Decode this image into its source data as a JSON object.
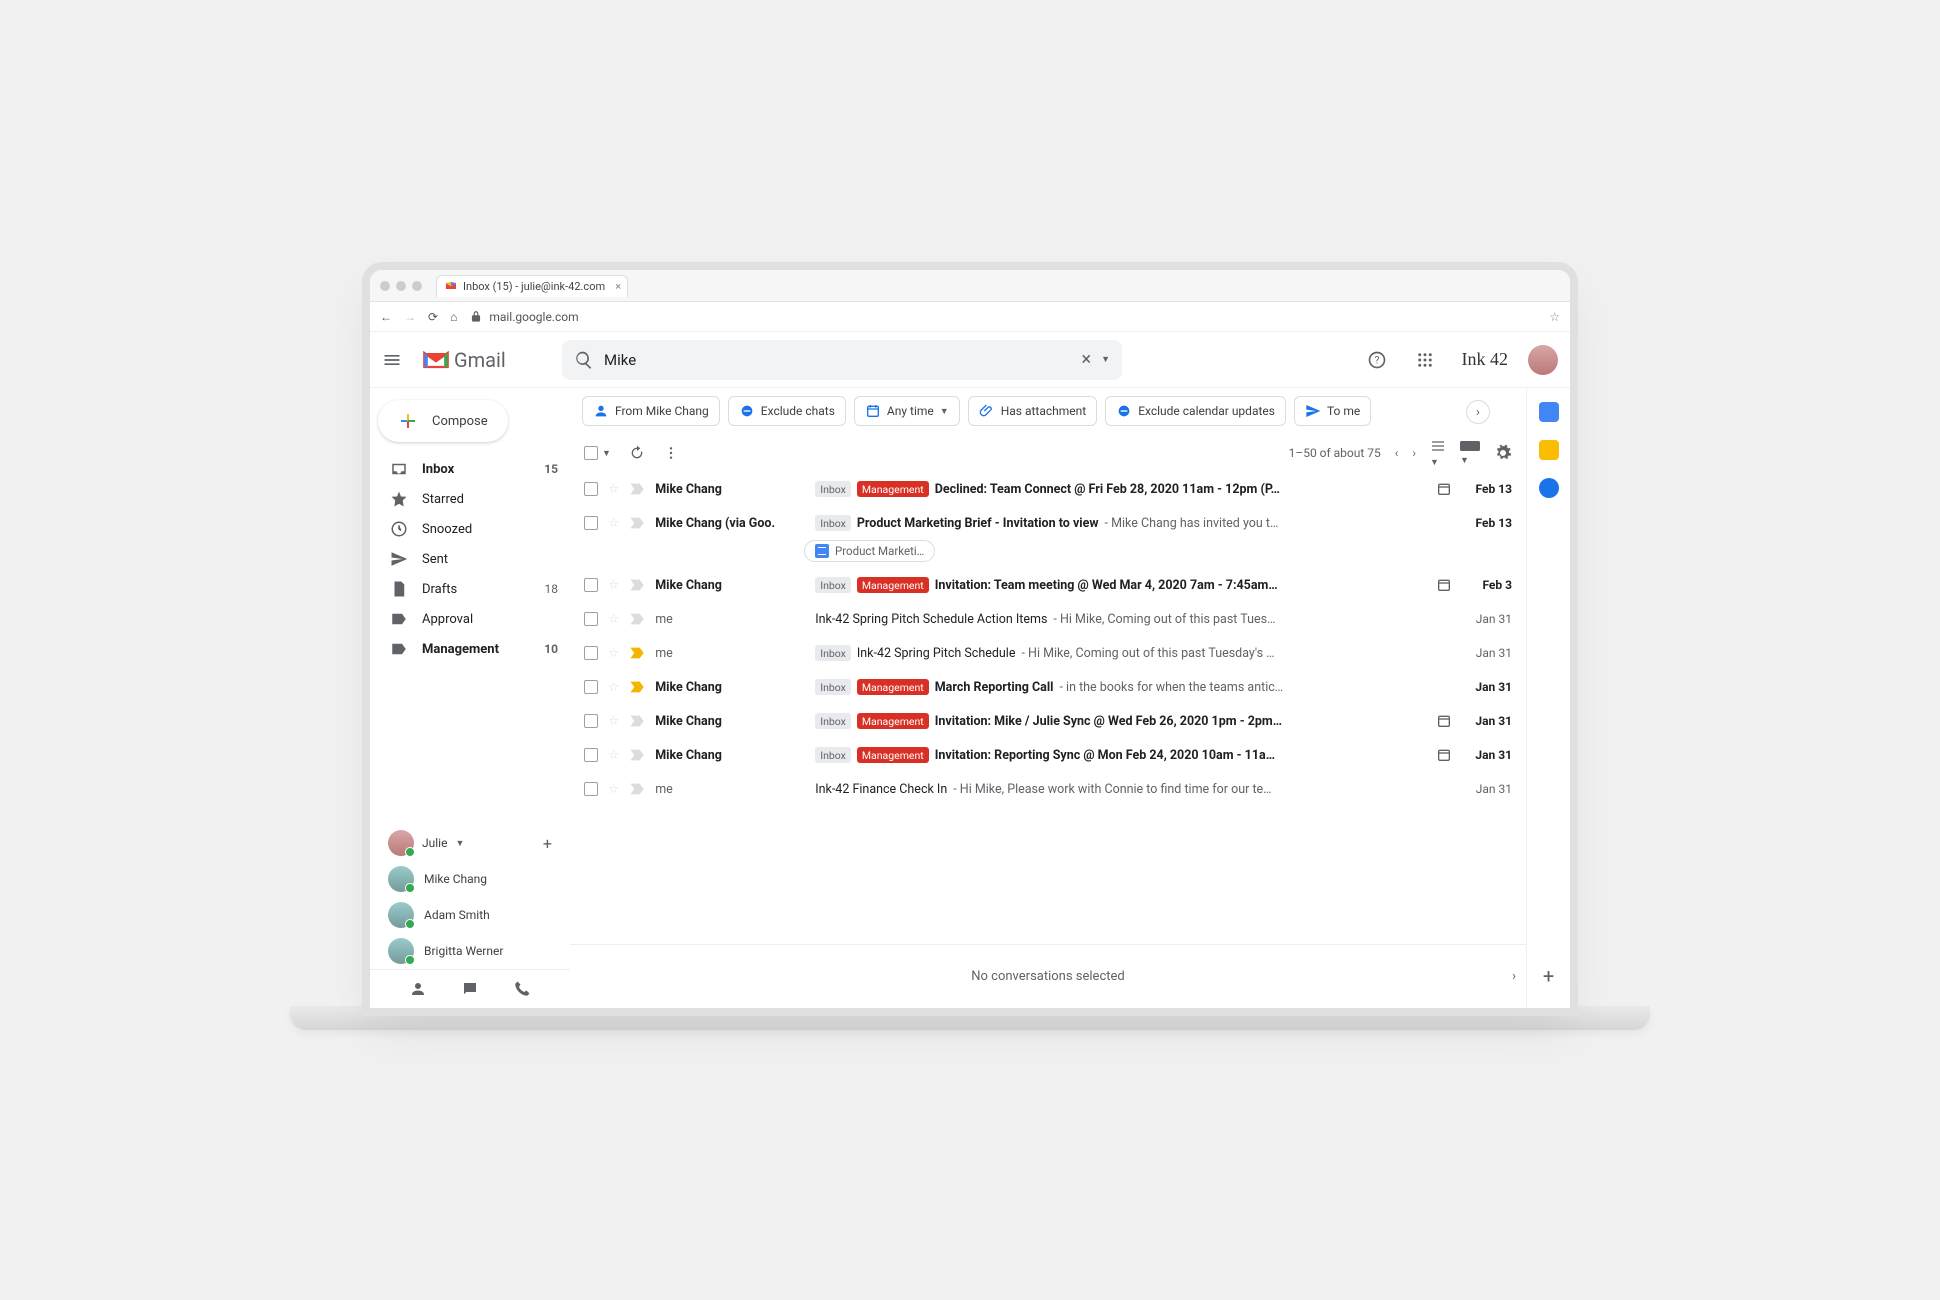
{
  "browser": {
    "tab_title": "Inbox (15) - julie@ink-42.com",
    "url": "mail.google.com"
  },
  "header": {
    "product": "Gmail",
    "search_value": "Mike",
    "workspace_brand": "Ink 42"
  },
  "chips": [
    {
      "icon": "person",
      "label": "From Mike Chang"
    },
    {
      "icon": "exclude",
      "label": "Exclude chats"
    },
    {
      "icon": "calendar",
      "label": "Any time",
      "dropdown": true
    },
    {
      "icon": "attachment",
      "label": "Has attachment"
    },
    {
      "icon": "exclude",
      "label": "Exclude calendar updates"
    },
    {
      "icon": "send",
      "label": "To me"
    }
  ],
  "toolbar": {
    "range": "1–50 of about 75"
  },
  "sidebar": {
    "compose": "Compose",
    "items": [
      {
        "icon": "inbox",
        "label": "Inbox",
        "count": "15",
        "bold": true
      },
      {
        "icon": "star",
        "label": "Starred"
      },
      {
        "icon": "clock",
        "label": "Snoozed"
      },
      {
        "icon": "send",
        "label": "Sent"
      },
      {
        "icon": "file",
        "label": "Drafts",
        "count": "18"
      },
      {
        "icon": "label",
        "label": "Approval"
      },
      {
        "icon": "label-red",
        "label": "Management",
        "count": "10",
        "bold": true
      }
    ],
    "hangouts_user": "Julie",
    "contacts": [
      "Mike Chang",
      "Adam Smith",
      "Brigitta Werner"
    ]
  },
  "emails": [
    {
      "unread": true,
      "sender": "Mike Chang",
      "labels": [
        "Inbox",
        "Management"
      ],
      "subject": "Declined: Team Connect @ Fri Feb 28, 2020 11am - 12pm (P…",
      "cal": true,
      "date": "Feb 13"
    },
    {
      "unread": true,
      "sender": "Mike Chang (via Goo.",
      "labels": [
        "Inbox"
      ],
      "subject": "Product Marketing Brief - Invitation to view",
      "snippet": "Mike Chang has invited you t…",
      "date": "Feb 13",
      "attachment": "Product Marketi…"
    },
    {
      "unread": true,
      "sender": "Mike Chang",
      "labels": [
        "Inbox",
        "Management"
      ],
      "subject": "Invitation: Team meeting @ Wed Mar 4, 2020 7am - 7:45am…",
      "cal": true,
      "date": "Feb 3"
    },
    {
      "unread": false,
      "sender": "me",
      "labels": [],
      "subject": "Ink-42 Spring Pitch Schedule Action Items",
      "snippet": "Hi Mike, Coming out of this past Tues…",
      "date": "Jan 31"
    },
    {
      "unread": false,
      "important": true,
      "sender": "me",
      "labels": [
        "Inbox"
      ],
      "subject": "Ink-42 Spring Pitch Schedule",
      "snippet": "Hi Mike, Coming out of this past Tuesday's …",
      "date": "Jan 31"
    },
    {
      "unread": true,
      "important": true,
      "sender": "Mike Chang",
      "labels": [
        "Inbox",
        "Management"
      ],
      "subject": "March Reporting Call",
      "snippet": "in the books for when the teams antic…",
      "date": "Jan 31"
    },
    {
      "unread": true,
      "sender": "Mike Chang",
      "labels": [
        "Inbox",
        "Management"
      ],
      "subject": "Invitation: Mike / Julie Sync @ Wed Feb 26, 2020 1pm - 2pm…",
      "cal": true,
      "date": "Jan 31"
    },
    {
      "unread": true,
      "sender": "Mike Chang",
      "labels": [
        "Inbox",
        "Management"
      ],
      "subject": "Invitation: Reporting Sync @ Mon Feb 24, 2020 10am - 11a…",
      "cal": true,
      "date": "Jan 31"
    },
    {
      "unread": false,
      "sender": "me",
      "labels": [],
      "subject": "Ink-42 Finance Check In",
      "snippet": "Hi Mike, Please work with Connie to find time for our te…",
      "date": "Jan 31"
    }
  ],
  "footer": {
    "message": "No conversations selected"
  }
}
